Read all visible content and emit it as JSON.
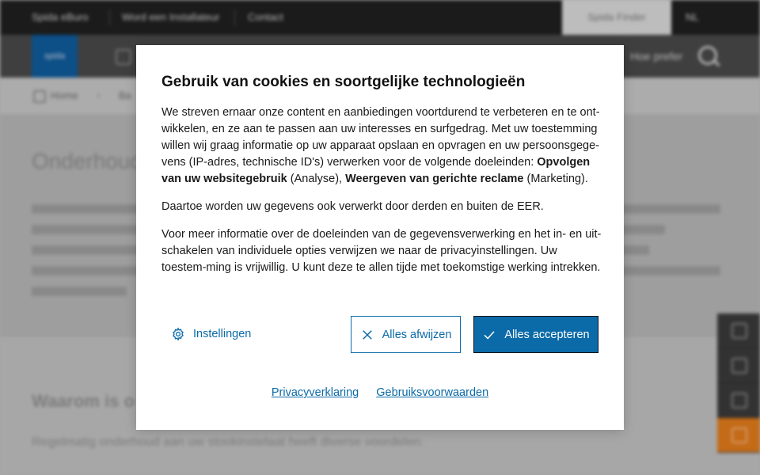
{
  "topbar": {
    "items": [
      "Spida eBuro",
      "Word een Installateur",
      "Contact"
    ],
    "finder_label": "Spida Finder",
    "language": "NL"
  },
  "navbar": {
    "logo": "spida",
    "right_text": "Hoe prefer"
  },
  "breadcrumb": {
    "home": "Home",
    "next": "Ba"
  },
  "hero": {
    "title": "Onderhoud"
  },
  "section": {
    "heading": "Waarom is o",
    "paragraph": "Regelmatig onderhoud aan uw stookinstelaat heeft diverse voordelen:"
  },
  "cookie_dialog": {
    "title": "Gebruik van cookies en soortgelijke technologieën",
    "p1_text": "We streven ernaar onze content en aanbiedingen voortdurend te verbeteren en te ont-wikkelen, en ze aan te passen aan uw interesses en surfgedrag. Met uw toestemming willen wij graag informatie op uw apparaat opslaan en opvragen en uw persoonsgege-vens (IP-adres, technische ID's) verwerken voor de volgende doeleinden: ",
    "p1_bold1": "Opvolgen van uw websitegebruik",
    "p1_mid": " (Analyse), ",
    "p1_bold2": "Weergeven van gerichte reclame",
    "p1_end": " (Marketing).",
    "p2": "Daartoe worden uw gegevens ook verwerkt door derden en buiten de EER.",
    "p3": "Voor meer informatie over de doeleinden van de gegevensverwerking en het in- en uit-schakelen van individuele opties verwijzen we naar de privacyinstellingen. Uw toestem-ming is vrijwillig. U kunt deze te allen tijde met toekomstige werking intrekken.",
    "settings_label": "Instellingen",
    "reject_label": "Alles afwijzen",
    "accept_label": "Alles accepteren",
    "privacy_link": "Privacyverklaring",
    "terms_link": "Gebruiksvoorwaarden"
  },
  "colors": {
    "brand_blue": "#0b6aa8",
    "accent_orange": "#e07a1c"
  },
  "icons": [
    "gear-icon",
    "close-icon",
    "check-icon",
    "search-icon",
    "home-icon"
  ]
}
